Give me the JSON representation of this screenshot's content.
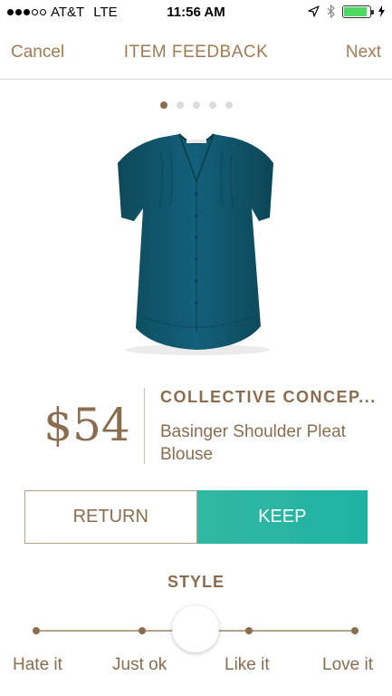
{
  "status_bar": {
    "carrier": "AT&T",
    "network": "LTE",
    "time": "11:56 AM",
    "battery_level": 0.9,
    "colors": {
      "battery": "#4cd964"
    },
    "icons": [
      "location-arrow-icon",
      "bluetooth-icon",
      "battery-icon",
      "charging-bolt-icon"
    ]
  },
  "nav": {
    "cancel_label": "Cancel",
    "title": "ITEM FEEDBACK",
    "next_label": "Next"
  },
  "pager": {
    "count": 5,
    "active_index": 0
  },
  "product": {
    "price": "$54",
    "brand": "COLLECTIVE CONCEP...",
    "name": "Basinger Shoulder Pleat Blouse",
    "image_icon": "teal-blouse-image"
  },
  "decision": {
    "return_label": "RETURN",
    "keep_label": "KEEP",
    "selected": "KEEP"
  },
  "style_rating": {
    "heading": "STYLE",
    "options": [
      "Hate it",
      "Just ok",
      "Like it",
      "Love it"
    ],
    "selected_position": 0.5
  },
  "colors": {
    "accent_brown": "#8a6d4e",
    "keep_teal": "#2bb5a3",
    "divider": "#d9d9d9"
  }
}
